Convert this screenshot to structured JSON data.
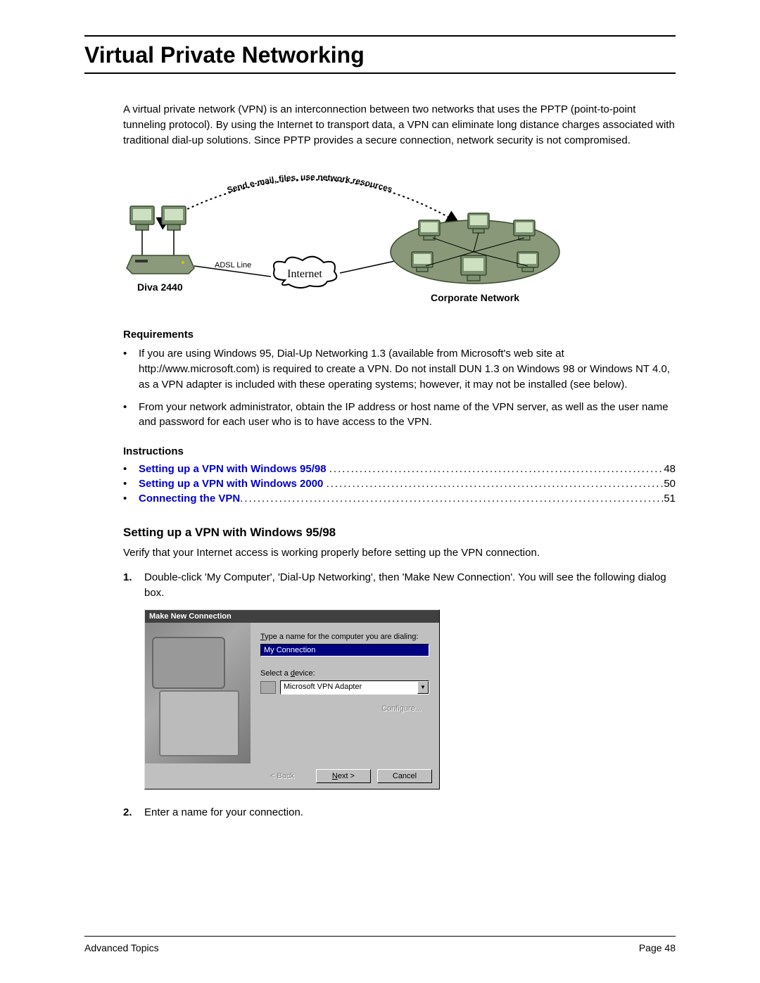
{
  "title": "Virtual Private Networking",
  "intro": "A virtual private network (VPN) is an interconnection between two networks that uses the PPTP (point-to-point tunneling protocol). By using the Internet to transport data, a VPN can eliminate long distance charges associated with traditional dial-up solutions. Since PPTP provides a secure connection, network security is not compromised.",
  "diagram": {
    "arc_text": "Send e-mail, files, use network resources",
    "left_label": "Diva 2440",
    "adsl_label": "ADSL Line",
    "internet_label": "Internet",
    "right_label": "Corporate Network"
  },
  "requirements": {
    "heading": "Requirements",
    "items": [
      "If you are using Windows 95, Dial-Up Networking 1.3 (available from Microsoft's web site at http://www.microsoft.com) is required to create a VPN. Do not install DUN 1.3 on Windows 98 or Windows NT 4.0, as a VPN adapter is included with these operating systems; however, it may not be installed (see below).",
      "From your network administrator, obtain the IP address or host name of the VPN server, as well as the user name and password for each user who is to have access to the VPN."
    ]
  },
  "instructions": {
    "heading": "Instructions",
    "items": [
      {
        "label": "Setting up a VPN with Windows 95/98",
        "page": "48"
      },
      {
        "label": "Setting up a VPN with Windows 2000",
        "page": "50"
      },
      {
        "label": "Connecting the VPN",
        "page": "51"
      }
    ]
  },
  "section": {
    "heading": "Setting up a VPN with Windows 95/98",
    "verify": "Verify that your Internet access is working properly before setting up the VPN connection.",
    "step1_num": "1.",
    "step1": "Double-click 'My Computer', 'Dial-Up Networking', then 'Make New Connection'. You will see the following dialog box.",
    "step2_num": "2.",
    "step2": "Enter a name for your connection."
  },
  "dialog": {
    "title": "Make New Connection",
    "type_label_prefix": "T",
    "type_label": "ype a name for the computer you are dialing:",
    "name_value": "My Connection",
    "device_label_prefix": "Select a ",
    "device_label_ul": "d",
    "device_label_suffix": "evice:",
    "device_value": "Microsoft VPN Adapter",
    "configure_label": "Configure...",
    "back_label": "< Back",
    "next_label": "Next >",
    "cancel_label": "Cancel"
  },
  "footer": {
    "left": "Advanced Topics",
    "right": "Page 48"
  }
}
